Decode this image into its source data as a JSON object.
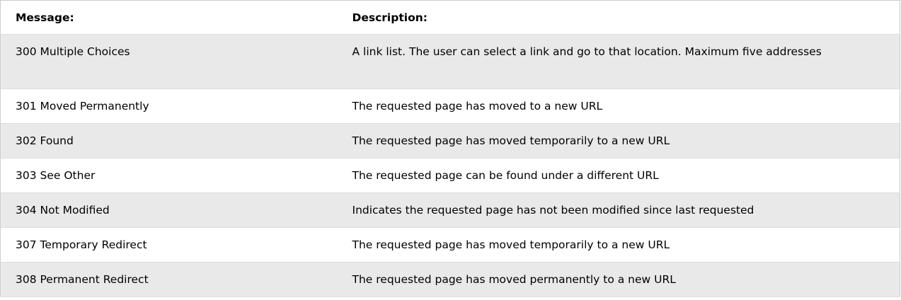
{
  "table": {
    "headers": {
      "message": "Message:",
      "description": "Description:"
    },
    "rows": [
      {
        "message": "300 Multiple Choices",
        "description": "A link list. The user can select a link and go to that location. Maximum five addresses"
      },
      {
        "message": "301 Moved Permanently",
        "description": "The requested page has moved to a new URL"
      },
      {
        "message": "302 Found",
        "description": "The requested page has moved temporarily to a new URL"
      },
      {
        "message": "303 See Other",
        "description": "The requested page can be found under a different URL"
      },
      {
        "message": "304 Not Modified",
        "description": "Indicates the requested page has not been modified since last requested"
      },
      {
        "message": "307 Temporary Redirect",
        "description": "The requested page has moved temporarily to a new URL"
      },
      {
        "message": "308 Permanent Redirect",
        "description": "The requested page has moved permanently to a new URL"
      }
    ]
  },
  "colors": {
    "stripe": "#e9e9ea",
    "background": "#ffffff",
    "border": "#dddddd"
  }
}
